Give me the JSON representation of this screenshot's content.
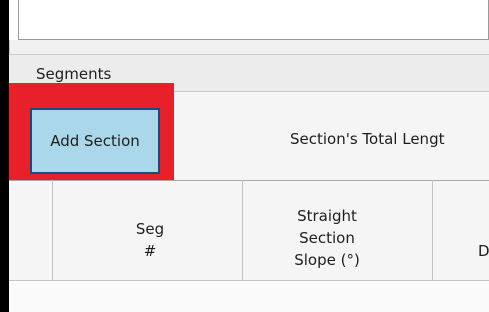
{
  "segments": {
    "tab_label": "Segments",
    "add_section_label": "Add Section",
    "total_length_label": "Section's Total Lengt"
  },
  "grid": {
    "columns": [
      {
        "line1": "Seg",
        "line2": "#"
      },
      {
        "line1": "Straight",
        "line2": "Section",
        "line3": "Slope (°)"
      },
      {
        "line1": "D"
      }
    ]
  },
  "colors": {
    "highlight": "#e8202a",
    "button_fill": "#aad8ea",
    "button_border": "#1b4a7e"
  }
}
